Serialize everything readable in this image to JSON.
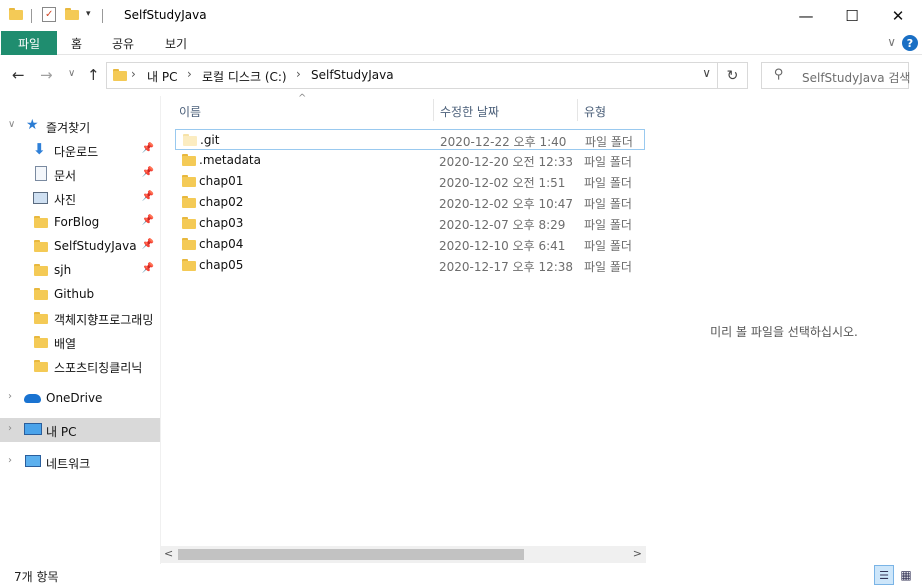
{
  "window": {
    "title": "SelfStudyJava",
    "minimize_glyph": "—",
    "maximize_glyph": "☐",
    "close_glyph": "✕"
  },
  "ribbon": {
    "tabs": [
      "파일",
      "홈",
      "공유",
      "보기"
    ],
    "accent_color": "#1f8d6f",
    "help_glyph": "?",
    "expand_glyph": "∨"
  },
  "nav": {
    "back_glyph": "←",
    "forward_glyph": "→",
    "recent_glyph": "∨",
    "up_glyph": "↑",
    "breadcrumbs": [
      "내 PC",
      "로컬 디스크 (C:)",
      "SelfStudyJava"
    ],
    "crumb_separator": "›",
    "refresh_glyph": "↻",
    "dropdown_glyph": "∨",
    "search_placeholder": "SelfStudyJava 검색"
  },
  "sidebar": {
    "quick_access": "즐겨찾기",
    "items": [
      {
        "label": "다운로드",
        "icon": "download-icon",
        "pinned": true
      },
      {
        "label": "문서",
        "icon": "document-icon",
        "pinned": true
      },
      {
        "label": "사진",
        "icon": "pictures-icon",
        "pinned": true
      },
      {
        "label": "ForBlog",
        "icon": "folder-icon",
        "pinned": true
      },
      {
        "label": "SelfStudyJava",
        "icon": "folder-icon",
        "pinned": true
      },
      {
        "label": "sjh",
        "icon": "folder-icon",
        "pinned": true
      },
      {
        "label": "Github",
        "icon": "folder-icon",
        "pinned": false
      },
      {
        "label": "객체지향프로그래밍",
        "icon": "folder-icon",
        "pinned": false
      },
      {
        "label": "배열",
        "icon": "folder-icon",
        "pinned": false
      },
      {
        "label": "스포츠티칭클리닉",
        "icon": "folder-icon",
        "pinned": false
      }
    ],
    "onedrive": "OneDrive",
    "this_pc": "내 PC",
    "network": "네트워크"
  },
  "columns": {
    "name": "이름",
    "date": "수정한 날짜",
    "type": "유형"
  },
  "files": [
    {
      "name": ".git",
      "date": "2020-12-22 오후 1:40",
      "type": "파일 폴더",
      "hidden": true
    },
    {
      "name": ".metadata",
      "date": "2020-12-20 오전 12:33",
      "type": "파일 폴더",
      "hidden": false
    },
    {
      "name": "chap01",
      "date": "2020-12-02 오전 1:51",
      "type": "파일 폴더",
      "hidden": false
    },
    {
      "name": "chap02",
      "date": "2020-12-02 오후 10:47",
      "type": "파일 폴더",
      "hidden": false
    },
    {
      "name": "chap03",
      "date": "2020-12-07 오후 8:29",
      "type": "파일 폴더",
      "hidden": false
    },
    {
      "name": "chap04",
      "date": "2020-12-10 오후 6:41",
      "type": "파일 폴더",
      "hidden": false
    },
    {
      "name": "chap05",
      "date": "2020-12-17 오후 12:38",
      "type": "파일 폴더",
      "hidden": false
    }
  ],
  "preview": {
    "empty_text": "미리 볼 파일을 선택하십시오."
  },
  "status": {
    "item_count": "7개 항목"
  }
}
